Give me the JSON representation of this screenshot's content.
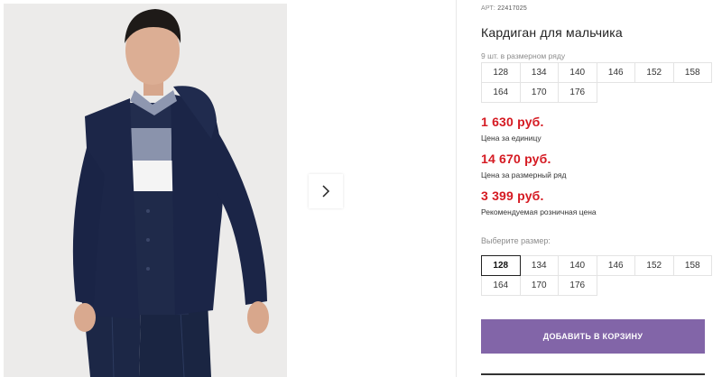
{
  "gallery": {
    "next_icon": "chevron-right-icon"
  },
  "product": {
    "article_label": "АРТ:",
    "article_number": "22417025",
    "title": "Кардиган для мальчика",
    "row_note": "9 шт. в размерном ряду",
    "size_row": [
      "128",
      "134",
      "140",
      "146",
      "152",
      "158",
      "164",
      "170",
      "176"
    ],
    "prices": [
      {
        "value": "1 630 руб.",
        "label": "Цена за единицу"
      },
      {
        "value": "14 670 руб.",
        "label": "Цена за размерный ряд"
      },
      {
        "value": "3 399 руб.",
        "label": "Рекомендуемая розничная цена"
      }
    ],
    "choose_label": "Выберите размер:",
    "sizes": [
      "128",
      "134",
      "140",
      "146",
      "152",
      "158",
      "164",
      "170",
      "176"
    ],
    "selected_size": "128",
    "add_to_cart_label": "ДОБАВИТЬ В КОРЗИНУ"
  },
  "colors": {
    "price": "#d51a22",
    "button": "#8265a8"
  }
}
